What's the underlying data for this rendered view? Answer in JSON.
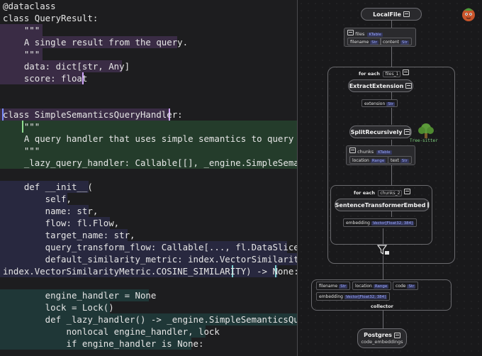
{
  "code": {
    "lines": [
      "@dataclass",
      "class QueryResult:",
      "    \"\"\"",
      "    A single result from the query.",
      "    \"\"\"",
      "    data: dict[str, Any]",
      "    score: float",
      "",
      "",
      "class SimpleSemanticsQueryHandler:",
      "    \"\"\"",
      "    A query handler that uses simple semantics to query the",
      "    \"\"\"",
      "    _lazy_query_handler: Callable[[], _engine.SimpleSemantic",
      "",
      "    def __init__(",
      "        self,",
      "        name: str,",
      "        flow: fl.Flow,",
      "        target_name: str,",
      "        query_transform_flow: Callable[..., fl.DataSlice],",
      "        default_similarity_metric: index.VectorSimilarityMet",
      "index.VectorSimilarityMetric.COSINE_SIMILARITY) -> None:",
      "",
      "        engine_handler = None",
      "        lock = Lock()",
      "        def _lazy_handler() -> _engine.SimpleSemanticsQueryH",
      "            nonlocal engine_handler, lock",
      "            if engine_handler is None:"
    ]
  },
  "graph": {
    "local_file": {
      "title": "LocalFile"
    },
    "files_table": {
      "name": "files",
      "type": "KTable",
      "fields": [
        {
          "name": "filename",
          "type": "Str"
        },
        {
          "name": "content",
          "type": "Str"
        }
      ]
    },
    "for_each_files": {
      "label": "for each",
      "target": "files_1"
    },
    "extract_extension": {
      "title": "ExtractExtension"
    },
    "extension_field": {
      "name": "extension",
      "type": "Str"
    },
    "split_recursively": {
      "title": "SplitRecursively"
    },
    "tree_sitter": {
      "label": "Tree-sitter"
    },
    "chunks_table": {
      "name": "chunks",
      "type": "KTable",
      "fields": [
        {
          "name": "location",
          "type": "Range"
        },
        {
          "name": "text",
          "type": "Str"
        }
      ]
    },
    "for_each_chunks": {
      "label": "for each",
      "target": "chunks_2"
    },
    "embed": {
      "title": "SentenceTransformerEmbed"
    },
    "embedding_field": {
      "name": "embedding",
      "type": "Vector[Float32, 384]"
    },
    "collector": {
      "label": "collector",
      "fields": [
        {
          "name": "filename",
          "type": "Str"
        },
        {
          "name": "location",
          "type": "Range"
        },
        {
          "name": "code",
          "type": "Str"
        },
        {
          "name": "embedding",
          "type": "Vector[Float32, 384]"
        }
      ]
    },
    "postgres": {
      "title": "Postgres",
      "subtitle": "code_embeddings"
    }
  },
  "colors": {
    "background": "#1d1d1f",
    "purple_highlight": "#3a2c45",
    "green_highlight": "#243c2b",
    "teal_highlight": "#1f3737",
    "type_tag": "#9aa8ff"
  }
}
